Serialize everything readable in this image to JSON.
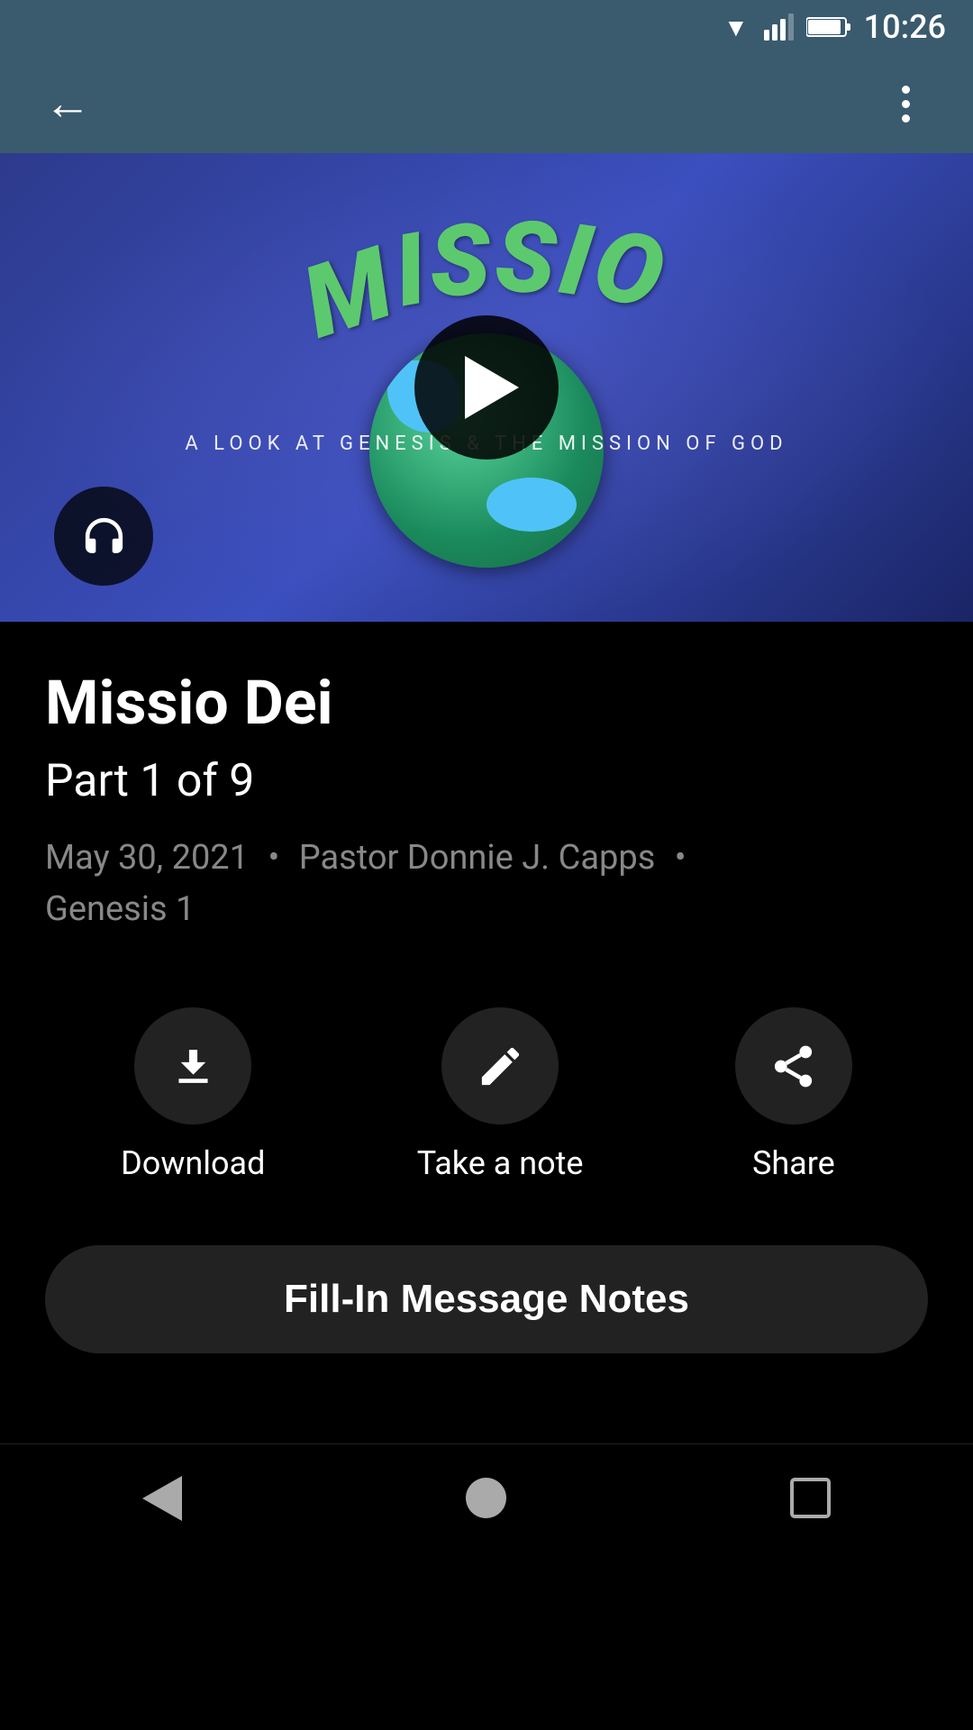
{
  "statusBar": {
    "time": "10:26"
  },
  "topNav": {
    "backLabel": "←",
    "moreLabel": "⋮"
  },
  "thumbnail": {
    "title": "MISSIO",
    "subtitle": "A LOOK AT GENESIS & THE MISSION OF GOD"
  },
  "sermon": {
    "title": "Missio Dei",
    "part": "Part 1 of 9",
    "date": "May 30, 2021",
    "pastor": "Pastor Donnie J. Capps",
    "scripture": "Genesis 1",
    "separator": "•"
  },
  "actions": {
    "download": "Download",
    "takeNote": "Take a note",
    "share": "Share"
  },
  "fillInBtn": "Fill-In Message Notes"
}
